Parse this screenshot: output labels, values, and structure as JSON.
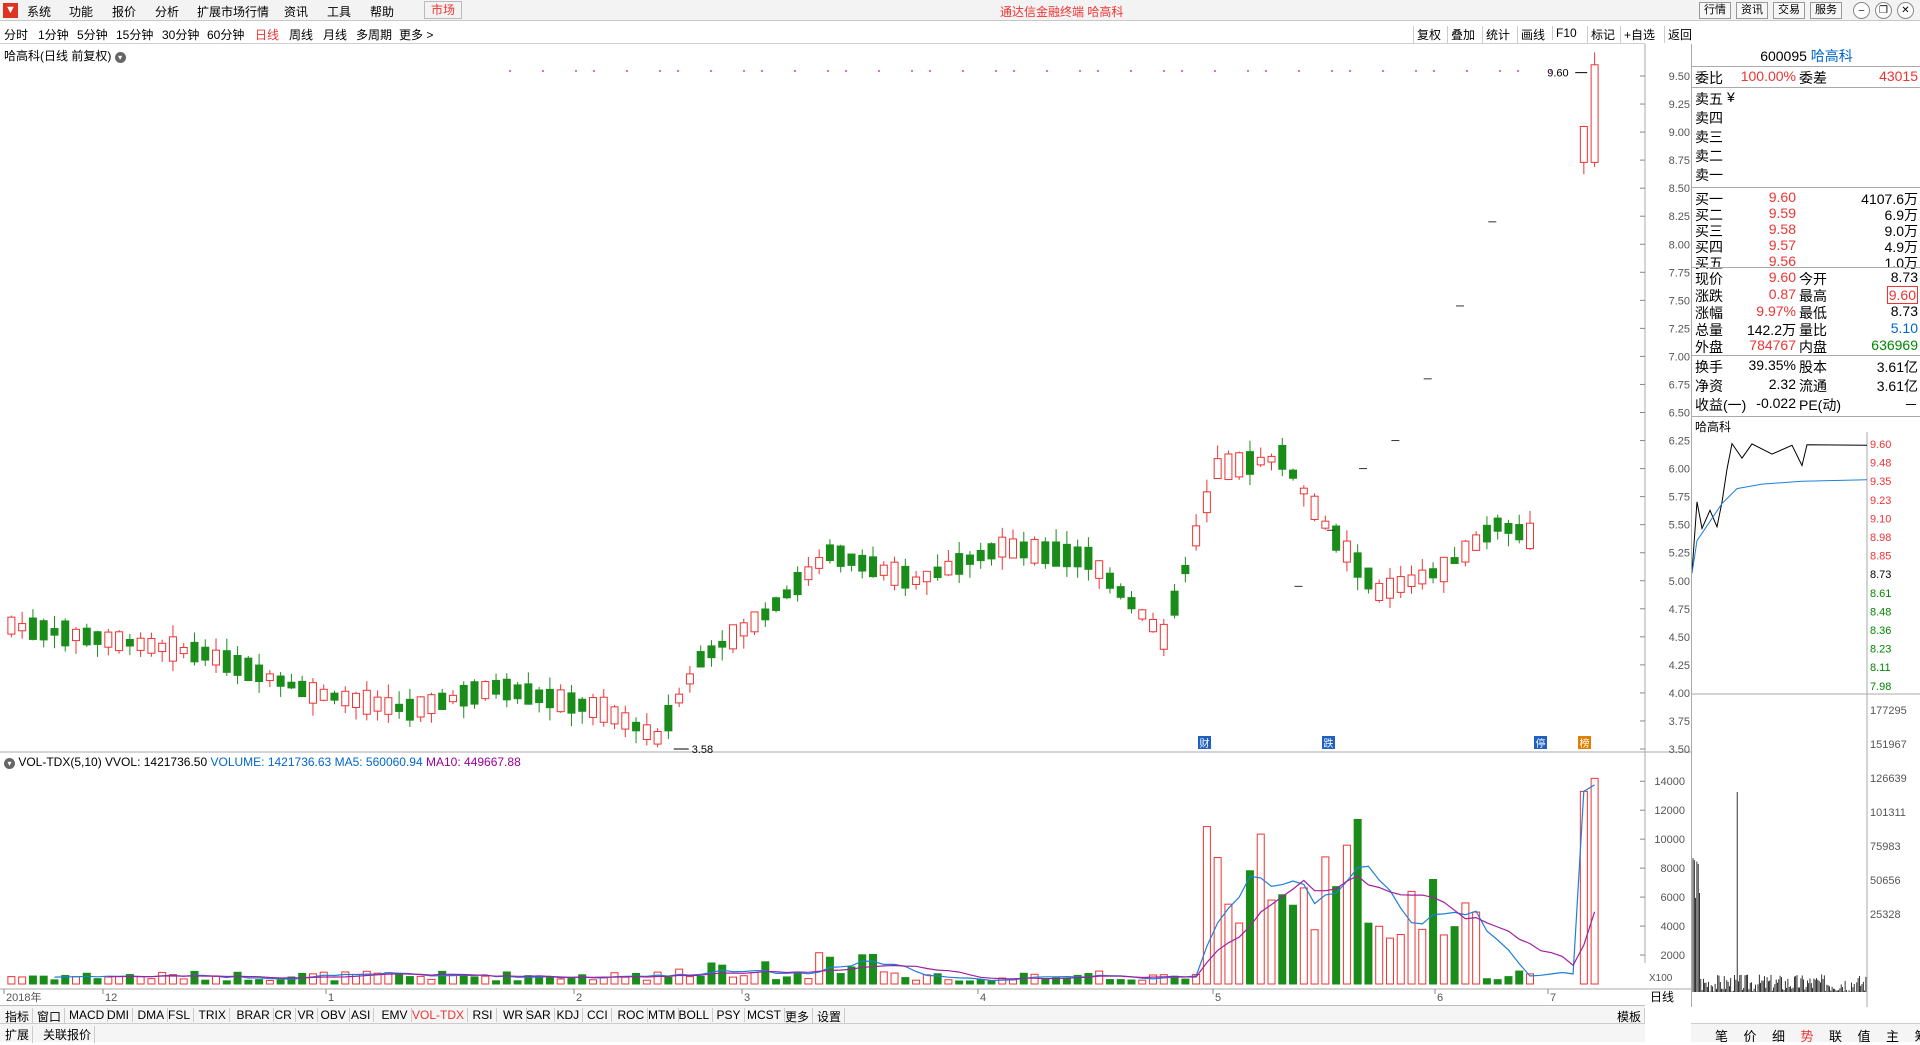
{
  "menu": {
    "items": [
      "系统",
      "功能",
      "报价",
      "分析",
      "扩展市场行情",
      "资讯",
      "工具",
      "帮助"
    ],
    "market": "市场",
    "title": "通达信金融终端 哈高科",
    "right_buttons": [
      "行情",
      "资讯",
      "交易",
      "服务"
    ]
  },
  "periods": {
    "items": [
      "分时",
      "1分钟",
      "5分钟",
      "15分钟",
      "30分钟",
      "60分钟",
      "日线",
      "周线",
      "月线",
      "多周期",
      "更多 >"
    ],
    "active": 6
  },
  "tools": [
    "复权",
    "叠加",
    "统计",
    "画线",
    "F10",
    "标记",
    "+自选",
    "返回"
  ],
  "chart": {
    "title": "哈高科(日线 前复权)",
    "low_label": "3.58",
    "high_label": "9.60",
    "markers": [
      "财",
      "跌",
      "停",
      "榜"
    ],
    "yticks": [
      "9.50",
      "9.25",
      "9.00",
      "8.75",
      "8.50",
      "8.25",
      "8.00",
      "7.75",
      "7.50",
      "7.25",
      "7.00",
      "6.75",
      "6.50",
      "6.25",
      "6.00",
      "5.75",
      "5.50",
      "5.25",
      "5.00",
      "4.75",
      "4.50",
      "4.25",
      "4.00",
      "3.75",
      "3.50"
    ],
    "xticks": [
      "2018年",
      "12",
      "1",
      "2",
      "3",
      "4",
      "5",
      "6",
      "7"
    ],
    "period_label": "日线"
  },
  "volume": {
    "indicator": "VOL-TDX(5,10)",
    "vvol": "VVOL: 1421736.50",
    "volume_label": "VOLUME: 1421736.63",
    "ma5_label": "MA5: 560060.94",
    "ma10_label": "MA10: 449667.88",
    "yticks": [
      "14000",
      "12000",
      "10000",
      "8000",
      "6000",
      "4000",
      "2000"
    ],
    "unit": "X100"
  },
  "bottom_tabs": [
    "指标",
    "窗口",
    "MACD",
    "DMI",
    "DMA",
    "FSL",
    "TRIX",
    "BRAR",
    "CR",
    "VR",
    "OBV",
    "ASI",
    "EMV",
    "VOL-TDX",
    "RSI",
    "WR",
    "SAR",
    "KDJ",
    "CCI",
    "ROC",
    "MTM",
    "BOLL",
    "PSY",
    "MCST",
    "更多",
    "设置"
  ],
  "bottom_active": "VOL-TDX",
  "template_label": "模板",
  "status": [
    "扩展",
    "关联报价"
  ],
  "quote": {
    "code": "600095",
    "name": "哈高科",
    "weibi_label": "委比",
    "weibi": "100.00%",
    "weicha_label": "委差",
    "weicha": "43015",
    "sells": [
      {
        "label": "卖五",
        "price": "",
        "vol": "",
        "mark": "¥"
      },
      {
        "label": "卖四",
        "price": "",
        "vol": ""
      },
      {
        "label": "卖三",
        "price": "",
        "vol": ""
      },
      {
        "label": "卖二",
        "price": "",
        "vol": ""
      },
      {
        "label": "卖一",
        "price": "",
        "vol": ""
      }
    ],
    "buys": [
      {
        "label": "买一",
        "price": "9.60",
        "vol": "4107.6万"
      },
      {
        "label": "买二",
        "price": "9.59",
        "vol": "6.9万"
      },
      {
        "label": "买三",
        "price": "9.58",
        "vol": "9.0万"
      },
      {
        "label": "买四",
        "price": "9.57",
        "vol": "4.9万"
      },
      {
        "label": "买五",
        "price": "9.56",
        "vol": "1.0万"
      }
    ],
    "stats": [
      {
        "l1": "现价",
        "v1": "9.60",
        "l2": "今开",
        "v2": "8.73"
      },
      {
        "l1": "涨跌",
        "v1": "0.87",
        "l2": "最高",
        "v2": "9.60"
      },
      {
        "l1": "涨幅",
        "v1": "9.97%",
        "l2": "最低",
        "v2": "8.73"
      },
      {
        "l1": "总量",
        "v1": "142.2万",
        "l2": "量比",
        "v2": "5.10"
      },
      {
        "l1": "外盘",
        "v1": "784767",
        "l2": "内盘",
        "v2": "636969"
      }
    ],
    "fund": [
      {
        "l1": "换手",
        "v1": "39.35%",
        "l2": "股本",
        "v2": "3.61亿"
      },
      {
        "l1": "净资",
        "v1": "2.32",
        "l2": "流通",
        "v2": "3.61亿"
      },
      {
        "l1": "收益(一)",
        "v1": "-0.022",
        "l2": "PE(动)",
        "v2": "－"
      }
    ],
    "mini_name": "哈高科",
    "mini_price_ticks": [
      "9.60",
      "9.48",
      "9.35",
      "9.23",
      "9.10",
      "8.98",
      "8.85",
      "8.73",
      "8.61",
      "8.48",
      "8.36",
      "8.23",
      "8.11",
      "7.98"
    ],
    "mini_vol_ticks": [
      "177295",
      "151967",
      "126639",
      "101311",
      "75983",
      "50656",
      "25328"
    ],
    "bottom_tabs": [
      "笔",
      "价",
      "细",
      "势",
      "联",
      "值",
      "主",
      "筹"
    ]
  },
  "colors": {
    "up": "#e33",
    "down": "#1a8c1a",
    "ma5": "#1e7fd8",
    "ma10": "#a020a0"
  },
  "chart_data": {
    "type": "candlestick",
    "x_range": [
      "2018年",
      "7"
    ],
    "last_close": 9.6,
    "low": 3.58,
    "high": 9.6
  }
}
